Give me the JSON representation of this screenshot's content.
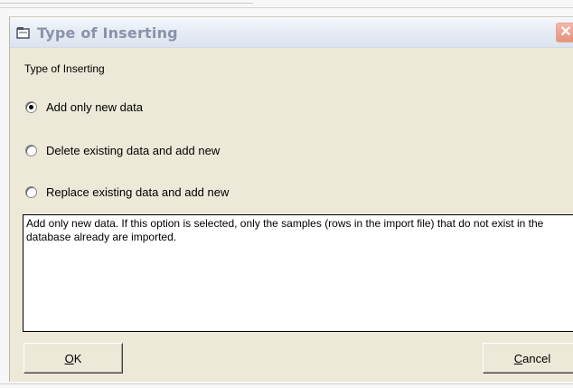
{
  "dialog": {
    "title": "Type of Inserting",
    "close_glyph": "✕"
  },
  "group_label": "Type of Inserting",
  "options": [
    {
      "label": "Add only new data",
      "checked": true
    },
    {
      "label": "Delete existing data and add new",
      "checked": false
    },
    {
      "label": "Replace existing data and add new",
      "checked": false
    }
  ],
  "description": "Add only new data. If this option is selected, only the samples (rows in the import file) that do not exist in the database already are imported.",
  "buttons": {
    "ok_mnemonic": "O",
    "ok_rest": "K",
    "cancel_mnemonic": "C",
    "cancel_rest": "ancel"
  },
  "colors": {
    "dialog_bg": "#ece9d8",
    "title_text": "#8a93aa",
    "close_button": "#e79279"
  }
}
